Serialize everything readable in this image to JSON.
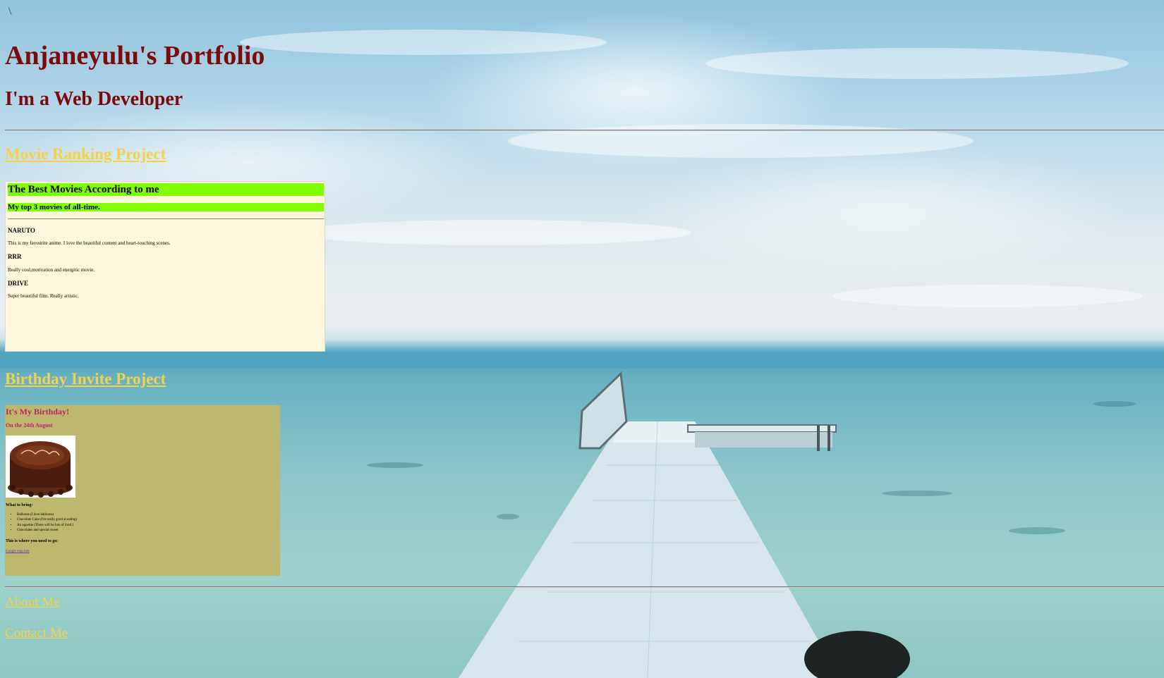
{
  "stray_char": "\\",
  "header": {
    "title": "Anjaneyulu's Portfolio",
    "subtitle": "I'm a Web Developer"
  },
  "projects": {
    "movie": {
      "link_label": "Movie Ranking Project",
      "heading": "The Best Movies According to me",
      "subheading": "My top 3 movies of all-time.",
      "movies": [
        {
          "name": "NARUTO",
          "desc": "This is my favourite anime. I love the beautiful content and heart-touching scenes."
        },
        {
          "name": "RRR",
          "desc": "Really cool,motivation and energitic movie."
        },
        {
          "name": "DRIVE",
          "desc": "Super beautiful film. Really artistic."
        }
      ]
    },
    "birthday": {
      "link_label": "Birthday Invite Project",
      "heading": "It's My Birthday!",
      "date": "On the 24th August",
      "cake_image_icon": "birthday-cake-image",
      "bring_heading": "What to bring:",
      "items": [
        "Balloons (I love balloons)",
        "Chocolate Cake (I'm really good at eating)",
        "An appetite (There will be lots of food.)",
        "Chocolates and special sweet"
      ],
      "where_heading": "This is where you need to go:",
      "map_link": "Google map link"
    }
  },
  "footer": {
    "about_label": "About Me",
    "contact_label": "Contact Me"
  },
  "colors": {
    "title": "#7d0a0a",
    "link": "#f3d24a",
    "movie_highlight": "#80ff00",
    "movie_bg": "#fff7dc",
    "birthday_bg": "#bdb86d",
    "birthday_heading": "#b5266a"
  }
}
